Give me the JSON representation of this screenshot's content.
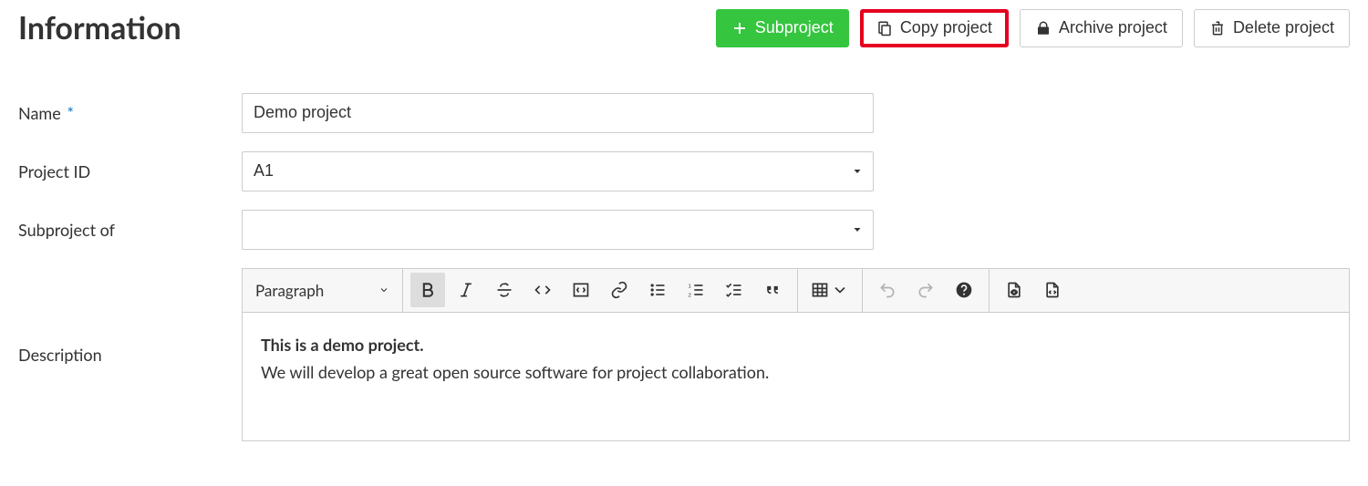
{
  "page": {
    "title": "Information"
  },
  "actions": {
    "subproject": "Subproject",
    "copy": "Copy project",
    "archive": "Archive project",
    "delete": "Delete project"
  },
  "labels": {
    "name": "Name",
    "project_id": "Project ID",
    "subproject_of": "Subproject of",
    "description": "Description"
  },
  "fields": {
    "name": "Demo project",
    "project_id": "A1",
    "subproject_of": ""
  },
  "editor": {
    "block_format": "Paragraph",
    "content_bold": "This is a demo project.",
    "content_line2": "We will develop a great open source software for project collaboration."
  }
}
